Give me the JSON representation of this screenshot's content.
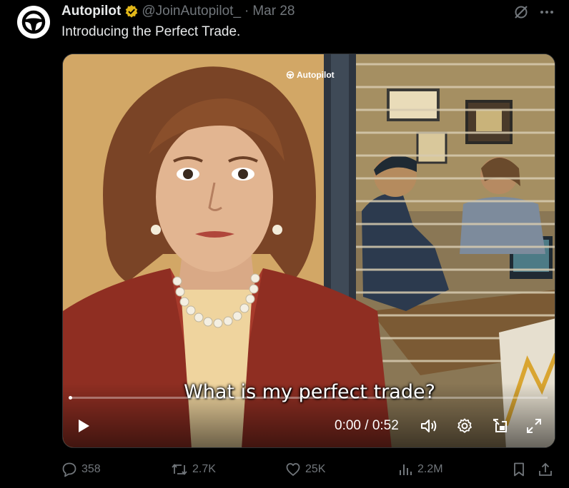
{
  "tweet": {
    "author_name": "Autopilot",
    "handle": "@JoinAutopilot_",
    "separator": "·",
    "date": "Mar 28",
    "text": "Introducing the Perfect Trade."
  },
  "icons": {
    "avatar": "steering-wheel-icon",
    "verified": "verified-badge-icon",
    "grok": "grok-icon",
    "more": "more-icon"
  },
  "colors": {
    "background": "#000000",
    "text": "#e7e9ea",
    "muted": "#71767b",
    "verified_gold": "#e2b719",
    "accent": "#1d9bf0"
  },
  "video": {
    "watermark": "Autopilot",
    "caption": "What is my perfect trade?",
    "time_display": "0:00 / 0:52",
    "progress": 0,
    "controls": [
      "play",
      "volume",
      "settings",
      "picture-in-picture",
      "fullscreen"
    ]
  },
  "actions": {
    "replies": "358",
    "reposts": "2.7K",
    "likes": "25K",
    "views": "2.2M"
  }
}
